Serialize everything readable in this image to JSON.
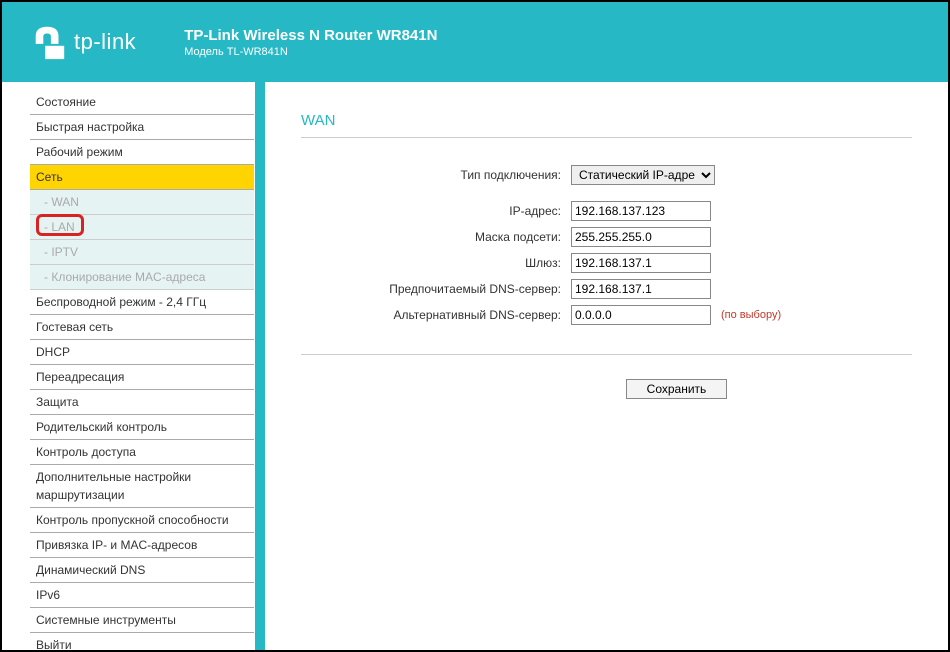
{
  "header": {
    "brand": "tp-link",
    "title": "TP-Link Wireless N Router WR841N",
    "subtitle": "Модель TL-WR841N"
  },
  "sidebar": {
    "items": [
      {
        "label": "Состояние",
        "type": "item"
      },
      {
        "label": "Быстрая настройка",
        "type": "item"
      },
      {
        "label": "Рабочий режим",
        "type": "item"
      },
      {
        "label": "Сеть",
        "type": "item",
        "active": true
      },
      {
        "label": "- WAN",
        "type": "sub"
      },
      {
        "label": "- LAN",
        "type": "sub",
        "highlighted": true
      },
      {
        "label": "- IPTV",
        "type": "sub"
      },
      {
        "label": "- Клонирование MAC-адреса",
        "type": "sub"
      },
      {
        "label": "Беспроводной режим - 2,4 ГГц",
        "type": "item"
      },
      {
        "label": "Гостевая сеть",
        "type": "item"
      },
      {
        "label": "DHCP",
        "type": "item"
      },
      {
        "label": "Переадресация",
        "type": "item"
      },
      {
        "label": "Защита",
        "type": "item"
      },
      {
        "label": "Родительский контроль",
        "type": "item"
      },
      {
        "label": "Контроль доступа",
        "type": "item"
      },
      {
        "label": "Дополнительные настройки маршрутизации",
        "type": "item"
      },
      {
        "label": "Контроль пропускной способности",
        "type": "item"
      },
      {
        "label": "Привязка IP- и MAC-адресов",
        "type": "item"
      },
      {
        "label": "Динамический DNS",
        "type": "item"
      },
      {
        "label": "IPv6",
        "type": "item"
      },
      {
        "label": "Системные инструменты",
        "type": "item"
      },
      {
        "label": "Выйти",
        "type": "item"
      }
    ]
  },
  "main": {
    "title": "WAN",
    "fields": {
      "conn_type_label": "Тип подключения:",
      "conn_type_value": "Статический IP-адрес",
      "ip_label": "IP-адрес:",
      "ip_value": "192.168.137.123",
      "mask_label": "Маска подсети:",
      "mask_value": "255.255.255.0",
      "gw_label": "Шлюз:",
      "gw_value": "192.168.137.1",
      "dns1_label": "Предпочитаемый DNS-сервер:",
      "dns1_value": "192.168.137.1",
      "dns2_label": "Альтернативный DNS-сервер:",
      "dns2_value": "0.0.0.0",
      "dns2_hint": "(по выбору)"
    },
    "save_label": "Сохранить"
  }
}
